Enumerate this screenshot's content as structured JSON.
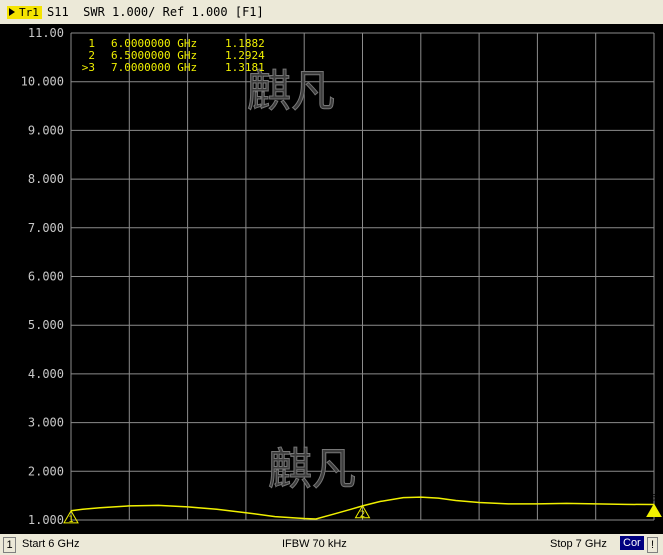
{
  "header": {
    "trace_tag": "Tr1",
    "title": "S11  SWR 1.000/ Ref 1.000 [F1]"
  },
  "markers_table": [
    {
      "id": "1",
      "freq": "6.0000000 GHz",
      "value": "1.1882"
    },
    {
      "id": "2",
      "freq": "6.5000000 GHz",
      "value": "1.2924"
    },
    {
      "id": ">3",
      "freq": "7.0000000 GHz",
      "value": "1.3181"
    }
  ],
  "watermark": "麒凡",
  "statusbar": {
    "channel": "1",
    "start": "Start 6 GHz",
    "ifbw": "IFBW 70 kHz",
    "stop": "Stop 7 GHz",
    "correction": "Cor",
    "warning": "!"
  },
  "colors": {
    "background": "#000000",
    "grid": "#8c8c8c",
    "trace": "#f0f000",
    "text": "#f0f000"
  },
  "chart_data": {
    "type": "line",
    "x_unit": "GHz",
    "xlim": [
      6,
      7
    ],
    "ylim": [
      1.0,
      11.0
    ],
    "y_ticks": [
      "11.00",
      "10.000",
      "9.000",
      "8.000",
      "7.000",
      "6.000",
      "5.000",
      "4.000",
      "3.000",
      "2.000",
      "1.000"
    ],
    "grid": true,
    "x_divisions": 10,
    "series": [
      {
        "x": [
          6.0,
          6.02,
          6.05,
          6.1,
          6.15,
          6.2,
          6.25,
          6.3,
          6.35,
          6.4,
          6.42,
          6.45,
          6.48,
          6.5,
          6.53,
          6.57,
          6.6,
          6.63,
          6.66,
          6.7,
          6.75,
          6.8,
          6.85,
          6.9,
          6.95,
          7.0
        ],
        "y": [
          1.19,
          1.22,
          1.25,
          1.29,
          1.3,
          1.27,
          1.22,
          1.15,
          1.07,
          1.03,
          1.02,
          1.12,
          1.22,
          1.29,
          1.38,
          1.46,
          1.47,
          1.45,
          1.4,
          1.36,
          1.33,
          1.33,
          1.34,
          1.33,
          1.32,
          1.318
        ]
      }
    ],
    "markers": [
      {
        "id": "1",
        "x": 6.0,
        "y": 1.1882
      },
      {
        "id": "2",
        "x": 6.5,
        "y": 1.2924
      },
      {
        "id": "3",
        "x": 7.0,
        "y": 1.3181,
        "active": true
      }
    ]
  }
}
